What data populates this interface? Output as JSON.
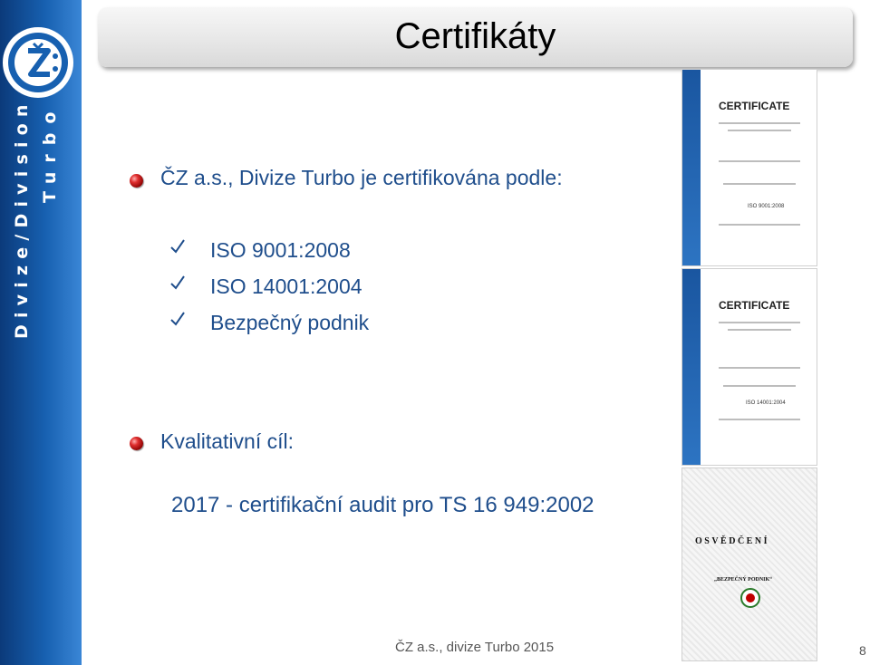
{
  "sidebar": {
    "line1": "Divize/Division",
    "line2": "Turbo"
  },
  "title": "Certifikáty",
  "intro": "ČZ a.s., Divize Turbo je certifikována podle:",
  "certifications": [
    "ISO 9001:2008",
    "ISO 14001:2004",
    "Bezpečný podnik"
  ],
  "quality_goal_label": "Kvalitativní cíl:",
  "quality_goal": "2017 - certifikační audit pro TS 16 949:2002",
  "thumbnails": {
    "cert1": {
      "heading": "CERTIFICATE",
      "standard": "ISO 9001:2008"
    },
    "cert2": {
      "heading": "CERTIFICATE",
      "standard": "ISO 14001:2004"
    },
    "cert3": {
      "heading": "OSVĚDČENÍ",
      "sub": "„BEZPEČNÝ PODNIK“"
    }
  },
  "footer": "ČZ a.s., divize Turbo 2015",
  "page_number": "8",
  "colors": {
    "sidebar": "#1760b0",
    "text_blue": "#1f4e8c",
    "bullet_red": "#c00000",
    "check_blue": "#1f4e8c"
  }
}
